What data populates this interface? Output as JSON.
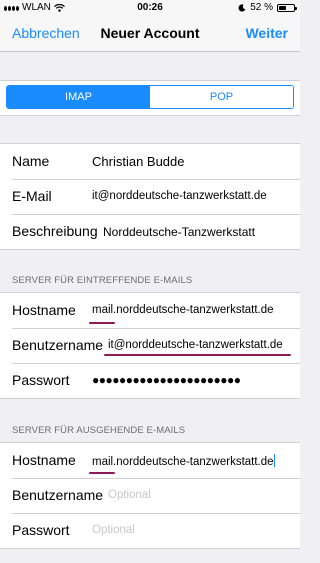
{
  "status_bar": {
    "carrier": "WLAN",
    "time": "00:26",
    "battery": "52 %",
    "battery_level": 0.52,
    "icons": [
      "signal-icon",
      "wifi-icon",
      "moon-icon",
      "battery-icon"
    ]
  },
  "nav": {
    "cancel": "Abbrechen",
    "title": "Neuer Account",
    "next": "Weiter"
  },
  "segment": {
    "options": [
      "IMAP",
      "POP"
    ],
    "selected": "IMAP"
  },
  "account": {
    "name_label": "Name",
    "name_value": "Christian Budde",
    "email_label": "E-Mail",
    "email_value": "it@norddeutsche-tanzwerkstatt.de",
    "description_label": "Beschreibung",
    "description_value": "Norddeutsche-Tanzwerkstatt"
  },
  "incoming": {
    "header": "SERVER FÜR EINTREFFENDE E-MAILS",
    "host_label": "Hostname",
    "host_value": "mail.norddeutsche-tanzwerkstatt.de",
    "user_label": "Benutzername",
    "user_value": "it@norddeutsche-tanzwerkstatt.de",
    "password_label": "Passwort",
    "password_value": "●●●●●●●●●●●●●●●●●●●●●●"
  },
  "outgoing": {
    "header": "SERVER FÜR AUSGEHENDE E-MAILS",
    "host_label": "Hostname",
    "host_value": "mail.norddeutsche-tanzwerkstatt.de",
    "user_label": "Benutzername",
    "user_placeholder": "Optional",
    "password_label": "Passwort",
    "password_placeholder": "Optional"
  },
  "colors": {
    "accent": "#1a8cff",
    "annotation_underline": "#8b1a55",
    "background": "#efeff4"
  }
}
